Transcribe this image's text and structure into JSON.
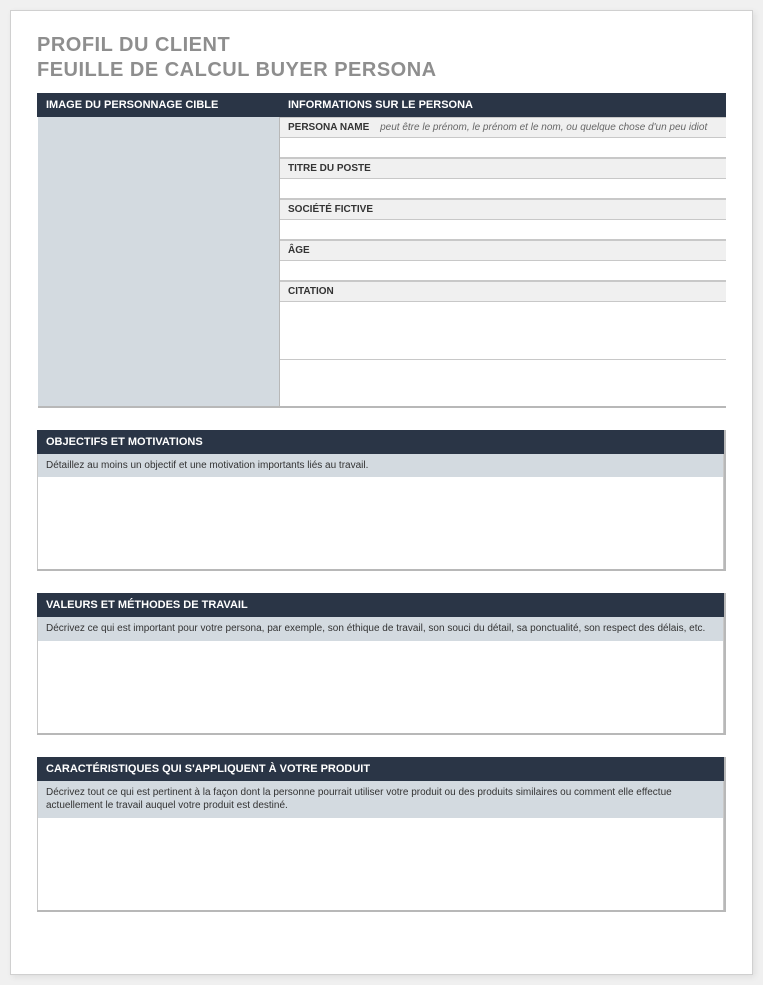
{
  "title_line1": "PROFIL DU CLIENT",
  "title_line2": "FEUILLE DE CALCUL BUYER PERSONA",
  "top": {
    "image_header": "IMAGE DU PERSONNAGE CIBLE",
    "info_header": "INFORMATIONS SUR LE PERSONA",
    "fields": {
      "persona_name": {
        "label": "PERSONA NAME",
        "hint": "peut être le prénom, le prénom et le nom, ou quelque chose d'un peu idiot",
        "value": ""
      },
      "job_title": {
        "label": "TITRE DU POSTE",
        "hint": "",
        "value": ""
      },
      "company": {
        "label": "SOCIÉTÉ FICTIVE",
        "hint": "",
        "value": ""
      },
      "age": {
        "label": "ÂGE",
        "hint": "",
        "value": ""
      },
      "quote": {
        "label": "CITATION",
        "hint": "",
        "value": ""
      }
    }
  },
  "sections": {
    "goals": {
      "header": "OBJECTIFS ET MOTIVATIONS",
      "desc": "Détaillez au moins un objectif et une motivation importants liés au travail.",
      "value": ""
    },
    "values": {
      "header": "VALEURS ET MÉTHODES DE TRAVAIL",
      "desc": "Décrivez ce qui est important pour votre persona, par exemple, son éthique de travail, son souci du détail, sa ponctualité, son respect des délais, etc.",
      "value": ""
    },
    "product": {
      "header": "CARACTÉRISTIQUES QUI S'APPLIQUENT À VOTRE PRODUIT",
      "desc": "Décrivez tout ce qui est pertinent à la façon dont la personne pourrait utiliser votre produit ou des produits similaires ou comment elle effectue actuellement le travail auquel votre produit est destiné.",
      "value": ""
    }
  }
}
